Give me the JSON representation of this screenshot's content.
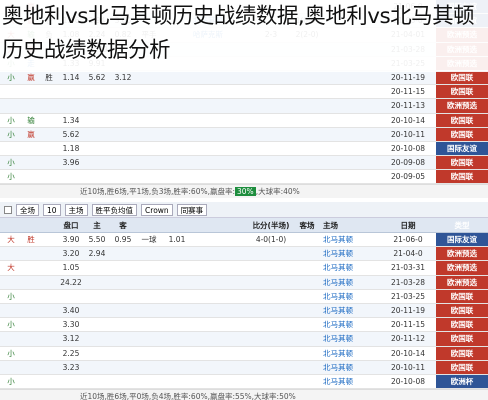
{
  "title": "奥地利vs北马其顿历史战绩数据,奥地利vs北马其顿历史战绩数据分析",
  "panel1": {
    "rows": [
      {
        "res": "大",
        "a": "赢",
        "b": "",
        "o1": "",
        "o2": "",
        "o3": "",
        "dir": "",
        "hcp": "",
        "away": "",
        "score": "",
        "half": "",
        "home": "",
        "date": "21-06-0",
        "type": "国际友谊"
      },
      {
        "res": "大",
        "a": "赢",
        "b": "胜",
        "o1": "1.06",
        "o2": "2.94",
        "o3": "3.00",
        "dir": "",
        "hcp": "",
        "away": "北马其顿",
        "score": "",
        "half": "1(0-0)",
        "home": "",
        "date": "21-06-0",
        "type": "国际友谊"
      },
      {
        "res": "大",
        "a": "输",
        "b": "负",
        "o1": "1.08",
        "o2": "2.24",
        "o3": "0.82",
        "dir": "平手",
        "hcp": "",
        "away": "哈萨克斯",
        "score": "2-3",
        "half": "2(2-0)",
        "home": "",
        "date": "21-04-01",
        "type": "欧洲预选"
      },
      {
        "res": "大",
        "a": "赢",
        "b": "",
        "o1": "10.40",
        "o2": "27.99",
        "o3": "",
        "dir": "",
        "hcp": "",
        "away": "",
        "score": "",
        "half": "",
        "home": "",
        "date": "21-03-28",
        "type": "欧洲预选"
      },
      {
        "res": "小",
        "a": "走",
        "b": "",
        "o1": "1.33",
        "o2": "9.91",
        "o3": "",
        "dir": "",
        "hcp": "",
        "away": "",
        "score": "",
        "half": "",
        "home": "",
        "date": "21-03-25",
        "type": "欧洲预选"
      },
      {
        "res": "小",
        "a": "赢",
        "b": "胜",
        "o1": "1.14",
        "o2": "5.62",
        "o3": "3.12",
        "dir": "",
        "hcp": "",
        "away": "",
        "score": "",
        "half": "",
        "home": "",
        "date": "20-11-19",
        "type": "欧国联"
      },
      {
        "res": "",
        "a": "",
        "b": "",
        "o1": "",
        "o2": "",
        "o3": "",
        "dir": "",
        "hcp": "",
        "away": "",
        "score": "",
        "half": "",
        "home": "",
        "date": "20-11-15",
        "type": "欧国联"
      },
      {
        "res": "",
        "a": "",
        "b": "",
        "o1": "",
        "o2": "",
        "o3": "",
        "dir": "",
        "hcp": "",
        "away": "",
        "score": "",
        "half": "",
        "home": "",
        "date": "20-11-13",
        "type": "欧洲预选"
      },
      {
        "res": "小",
        "a": "输",
        "b": "",
        "o1": "1.34",
        "o2": "",
        "o3": "",
        "dir": "",
        "hcp": "",
        "away": "",
        "score": "",
        "half": "",
        "home": "",
        "date": "20-10-14",
        "type": "欧国联"
      },
      {
        "res": "小",
        "a": "赢",
        "b": "",
        "o1": "5.62",
        "o2": "",
        "o3": "",
        "dir": "",
        "hcp": "",
        "away": "",
        "score": "",
        "half": "",
        "home": "",
        "date": "20-10-11",
        "type": "欧国联"
      },
      {
        "res": "",
        "a": "",
        "b": "",
        "o1": "1.18",
        "o2": "",
        "o3": "",
        "dir": "",
        "hcp": "",
        "away": "",
        "score": "",
        "half": "",
        "home": "",
        "date": "20-10-08",
        "type": "国际友谊"
      },
      {
        "res": "小",
        "a": "",
        "b": "",
        "o1": "3.96",
        "o2": "",
        "o3": "",
        "dir": "",
        "hcp": "",
        "away": "",
        "score": "",
        "half": "",
        "home": "",
        "date": "20-09-08",
        "type": "欧国联"
      },
      {
        "res": "小",
        "a": "",
        "b": "",
        "o1": "",
        "o2": "",
        "o3": "",
        "dir": "",
        "hcp": "",
        "away": "",
        "score": "",
        "half": "",
        "home": "",
        "date": "20-09-05",
        "type": "欧国联"
      }
    ],
    "footer": "近10场,胜6场,平1场,负3场,胜率:60%,赢盘率:",
    "footer_hl": "30%",
    "footer_tail": ",大球率:40%"
  },
  "toolbar": {
    "items": [
      "全场",
      "10",
      "主场",
      "胜平负均值",
      "Crown",
      "同赛事"
    ]
  },
  "panel2": {
    "header": [
      "",
      "",
      "",
      "盘口",
      "主",
      "客",
      "",
      "",
      "",
      "比分(半场)",
      "客场",
      "主场",
      "日期",
      "类型"
    ],
    "rows": [
      {
        "res": "大",
        "a": "胜",
        "b": "",
        "o1": "3.90",
        "o2": "5.50",
        "o3": "0.95",
        "dir": "一球",
        "hcp": "1.01",
        "away": "",
        "score": "4-0(1-0)",
        "half": "",
        "home": "北马其顿",
        "date": "21-06-0",
        "type": "国际友谊"
      },
      {
        "res": "",
        "a": "",
        "b": "",
        "o1": "3.20",
        "o2": "2.94",
        "o3": "",
        "dir": "",
        "hcp": "",
        "away": "",
        "score": "",
        "half": "",
        "home": "北马其顿",
        "date": "21-04-0",
        "type": "欧洲预选"
      },
      {
        "res": "大",
        "a": "",
        "b": "",
        "o1": "1.05",
        "o2": "",
        "o3": "",
        "dir": "",
        "hcp": "",
        "away": "",
        "score": "",
        "half": "",
        "home": "北马其顿",
        "date": "21-03-31",
        "type": "欧洲预选"
      },
      {
        "res": "",
        "a": "",
        "b": "",
        "o1": "24.22",
        "o2": "",
        "o3": "",
        "dir": "",
        "hcp": "",
        "away": "",
        "score": "",
        "half": "",
        "home": "北马其顿",
        "date": "21-03-28",
        "type": "欧洲预选"
      },
      {
        "res": "小",
        "a": "",
        "b": "",
        "o1": "",
        "o2": "",
        "o3": "",
        "dir": "",
        "hcp": "",
        "away": "",
        "score": "",
        "half": "",
        "home": "北马其顿",
        "date": "21-03-25",
        "type": "欧国联"
      },
      {
        "res": "",
        "a": "",
        "b": "",
        "o1": "3.40",
        "o2": "",
        "o3": "",
        "dir": "",
        "hcp": "",
        "away": "",
        "score": "",
        "half": "",
        "home": "北马其顿",
        "date": "20-11-19",
        "type": "欧国联"
      },
      {
        "res": "小",
        "a": "",
        "b": "",
        "o1": "3.30",
        "o2": "",
        "o3": "",
        "dir": "",
        "hcp": "",
        "away": "",
        "score": "",
        "half": "",
        "home": "北马其顿",
        "date": "20-11-15",
        "type": "欧国联"
      },
      {
        "res": "",
        "a": "",
        "b": "",
        "o1": "3.12",
        "o2": "",
        "o3": "",
        "dir": "",
        "hcp": "",
        "away": "",
        "score": "",
        "half": "",
        "home": "北马其顿",
        "date": "20-11-12",
        "type": "欧国联"
      },
      {
        "res": "小",
        "a": "",
        "b": "",
        "o1": "2.25",
        "o2": "",
        "o3": "",
        "dir": "",
        "hcp": "",
        "away": "",
        "score": "",
        "half": "",
        "home": "北马其顿",
        "date": "20-10-14",
        "type": "欧国联"
      },
      {
        "res": "",
        "a": "",
        "b": "",
        "o1": "3.23",
        "o2": "",
        "o3": "",
        "dir": "",
        "hcp": "",
        "away": "",
        "score": "",
        "half": "",
        "home": "北马其顿",
        "date": "20-10-11",
        "type": "欧国联"
      },
      {
        "res": "小",
        "a": "",
        "b": "",
        "o1": "",
        "o2": "",
        "o3": "",
        "dir": "",
        "hcp": "",
        "away": "",
        "score": "",
        "half": "",
        "home": "北马其顿",
        "date": "20-10-08",
        "type": "欧洲杯"
      }
    ],
    "footer": "近10场,胜6场,平0场,负4场,胜率:60%,赢盘率:55%,大球率:50%"
  }
}
